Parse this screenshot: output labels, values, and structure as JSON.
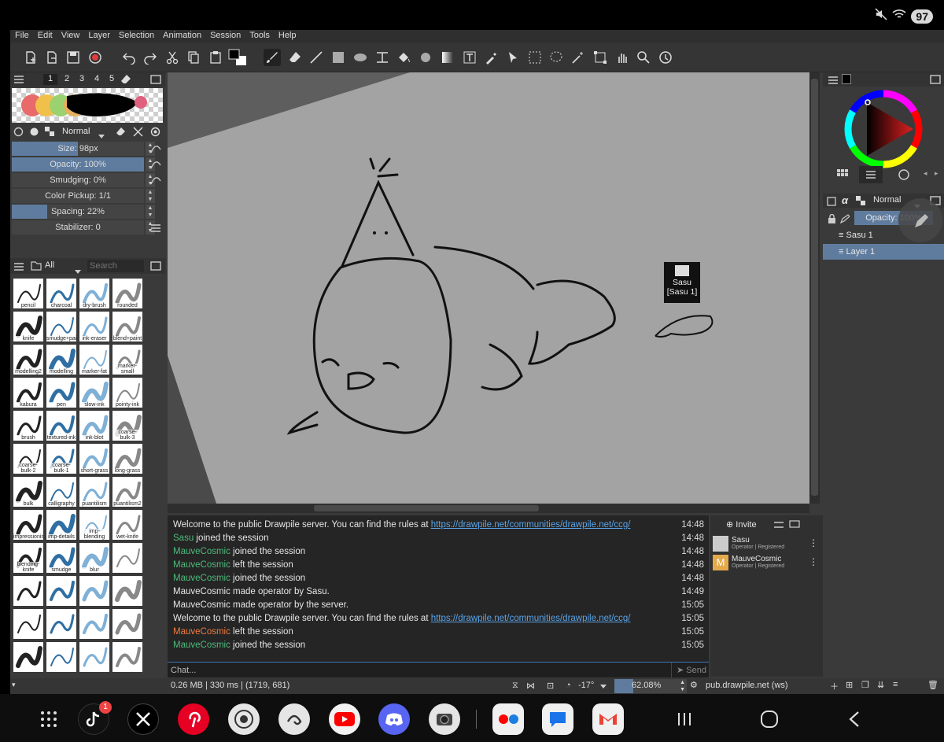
{
  "status": {
    "battery": "97"
  },
  "menu": [
    "File",
    "Edit",
    "View",
    "Layer",
    "Selection",
    "Animation",
    "Session",
    "Tools",
    "Help"
  ],
  "left_panel": {
    "color_tabs": [
      "1",
      "2",
      "3",
      "4",
      "5"
    ],
    "blend_mode": "Normal",
    "size_label": "Size: 98px",
    "opacity_label": "Opacity: 100%",
    "smudging_label": "Smudging: 0%",
    "pickup_label": "Color Pickup: 1/1",
    "spacing_label": "Spacing: 22%",
    "stabilizer_label": "Stabilizer: 0",
    "opacity_fill": 1.0,
    "spacing_fill": 0.27,
    "size_fill": 0.5,
    "brush_filter": "All",
    "brush_search_placeholder": "Search",
    "brushes": [
      "pencil",
      "charcoal",
      "dry-brush",
      "rounded",
      "knife",
      "smudge+paint",
      "ink-eraser",
      "blend+paint",
      "modelling2",
      "modelling",
      "marker-fat",
      "marker-small",
      "kabura",
      "pen",
      "slow-ink",
      "pointy-ink",
      "brush",
      "textured-ink",
      "ink-blot",
      "coarse-bulk-3",
      "coarse-bulk-2",
      "coarse-bulk-1",
      "short-grass",
      "long-grass",
      "bulk",
      "calligraphy",
      "puantilism",
      "puantilism2",
      "impressionism",
      "imp-details",
      "imp-blending",
      "wet-knife",
      "blending-knife",
      "smudge",
      "blur",
      "",
      "",
      "",
      "",
      "",
      "",
      "",
      "",
      "",
      "",
      "",
      "",
      ""
    ]
  },
  "canvas": {
    "user_tag_name": "Sasu",
    "user_tag_layer": "[Sasu 1]"
  },
  "chat": {
    "lines": [
      {
        "prefix": "",
        "user": "",
        "user_class": "",
        "text": "Welcome to the public Drawpile server. You can find the rules at ",
        "link": "https://drawpile.net/communities/drawpile.net/ccg/",
        "time": "14:48"
      },
      {
        "prefix": "",
        "user": "Sasu",
        "user_class": "green",
        "text": " joined the session",
        "link": "",
        "time": "14:48"
      },
      {
        "prefix": "",
        "user": "MauveCosmic",
        "user_class": "green",
        "text": " joined the session",
        "link": "",
        "time": "14:48"
      },
      {
        "prefix": "",
        "user": "MauveCosmic",
        "user_class": "green",
        "text": " left the session",
        "link": "",
        "time": "14:48"
      },
      {
        "prefix": "",
        "user": "MauveCosmic",
        "user_class": "green",
        "text": " joined the session",
        "link": "",
        "time": "14:48"
      },
      {
        "prefix": "",
        "user": "",
        "user_class": "",
        "text": "MauveCosmic made operator by Sasu.",
        "link": "",
        "time": "14:49"
      },
      {
        "prefix": "",
        "user": "",
        "user_class": "",
        "text": "MauveCosmic made operator by the server.",
        "link": "",
        "time": "15:05"
      },
      {
        "prefix": "",
        "user": "",
        "user_class": "",
        "text": "Welcome to the public Drawpile server. You can find the rules at ",
        "link": "https://drawpile.net/communities/drawpile.net/ccg/",
        "time": "15:05"
      },
      {
        "prefix": "",
        "user": "MauveCosmic",
        "user_class": "orange",
        "text": " left the session",
        "link": "",
        "time": "15:05"
      },
      {
        "prefix": "",
        "user": "MauveCosmic",
        "user_class": "green",
        "text": " joined the session",
        "link": "",
        "time": "15:05"
      }
    ],
    "input_placeholder": "Chat...",
    "send_label": "Send"
  },
  "users": {
    "invite_label": "Invite",
    "list": [
      {
        "name": "Sasu",
        "role": "Operator | Registered"
      },
      {
        "name": "MauveCosmic",
        "role": "Operator | Registered"
      }
    ],
    "mauve_initial": "M"
  },
  "right_panel": {
    "blend_mode": "Normal",
    "opacity_label": "Opacity: 100%",
    "layers": [
      "Sasu 1",
      "Layer 1"
    ]
  },
  "bottom_bar": {
    "info": "0.26 MB | 330 ms | (1719, 681)",
    "rotation": "-17°",
    "zoom": "62.08%",
    "server": "pub.drawpile.net (ws)"
  },
  "dock": {
    "tiktok_badge": "1"
  },
  "colors": {
    "accent": "#5f7c9e",
    "join_green": "#4dbb7a",
    "leave_orange": "#f07b3f",
    "link": "#5aa3e6"
  }
}
